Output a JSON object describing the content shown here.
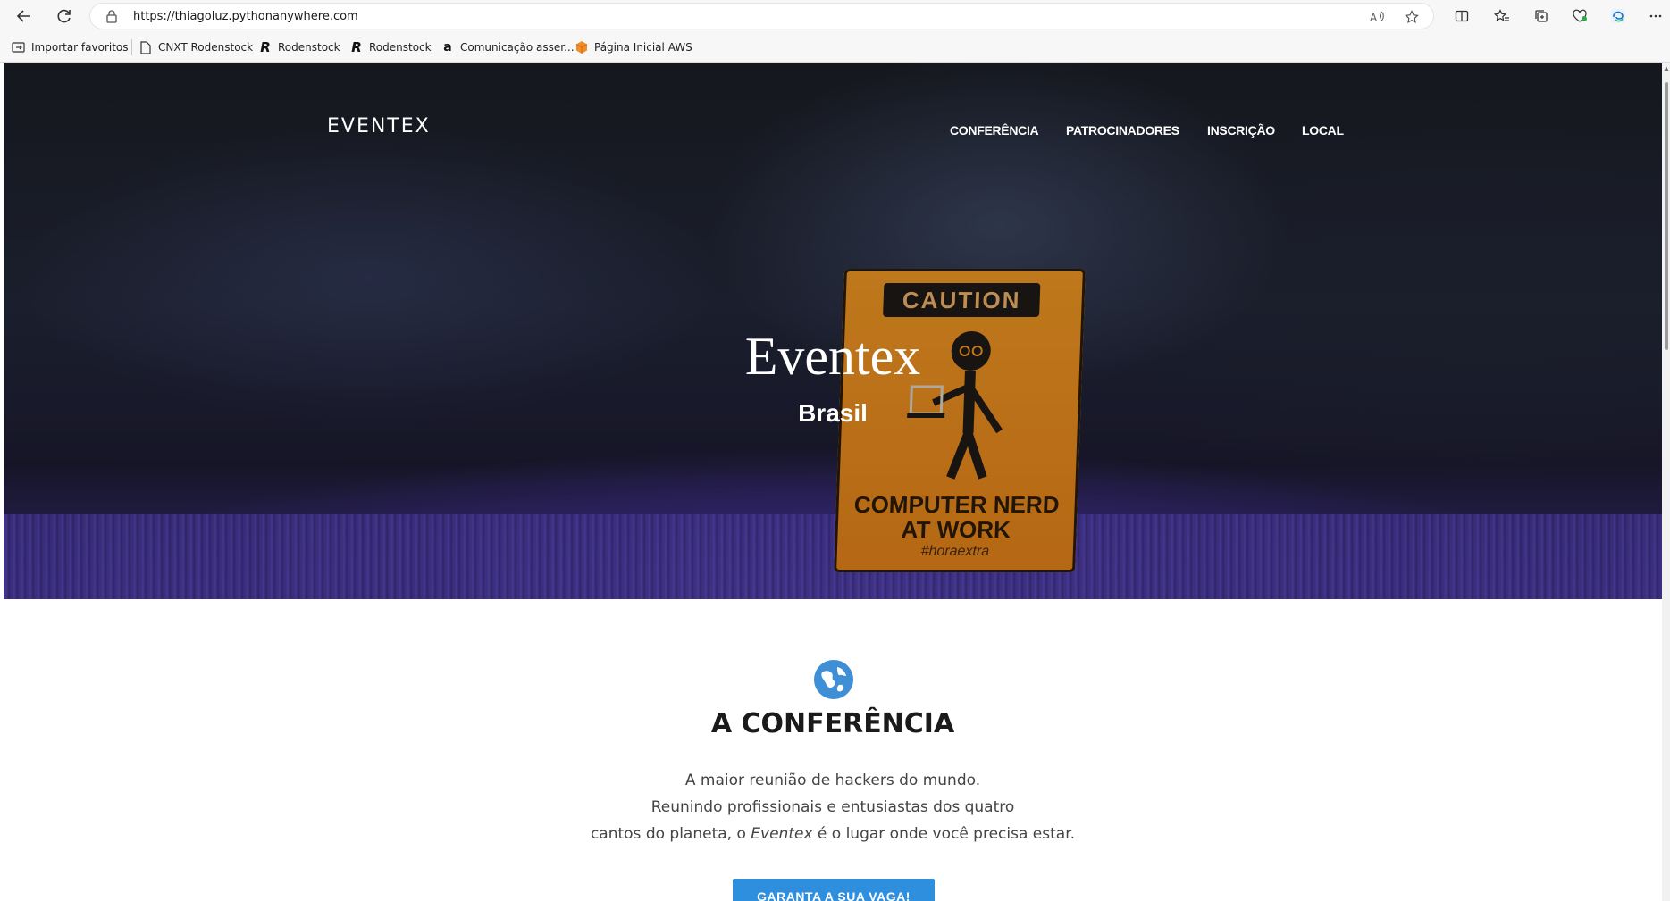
{
  "browser": {
    "url": "https://thiagoluz.pythonanywhere.com",
    "bookmarks": [
      {
        "label": "Importar favoritos"
      },
      {
        "label": "CNXT Rodenstock"
      },
      {
        "label": "Rodenstock"
      },
      {
        "label": "Rodenstock"
      },
      {
        "label": "Comunicação asser..."
      },
      {
        "label": "Página Inicial AWS"
      }
    ]
  },
  "site": {
    "brand": "EVENTEX",
    "nav": [
      "CONFERÊNCIA",
      "PATROCINADORES",
      "INSCRIÇÃO",
      "LOCAL"
    ]
  },
  "hero": {
    "title": "Eventex",
    "subtitle": "Brasil",
    "sign_head": "CAUTION",
    "sign_line1": "COMPUTER NERD",
    "sign_line2": "AT WORK",
    "sign_tag": "#horaextra"
  },
  "conference": {
    "title": "A CONFERÊNCIA",
    "line1": "A maior reunião de hackers do mundo.",
    "line2": "Reunindo profissionais e entusiastas dos quatro",
    "line3_a": "cantos do planeta, o ",
    "line3_em": "Eventex",
    "line3_b": " é o lugar onde você precisa estar.",
    "cta": "GARANTA A SUA VAGA!"
  },
  "colors": {
    "accent": "#2f8fdf",
    "sign_orange": "#f59a24",
    "floor_purple": "#4a3aa0"
  }
}
